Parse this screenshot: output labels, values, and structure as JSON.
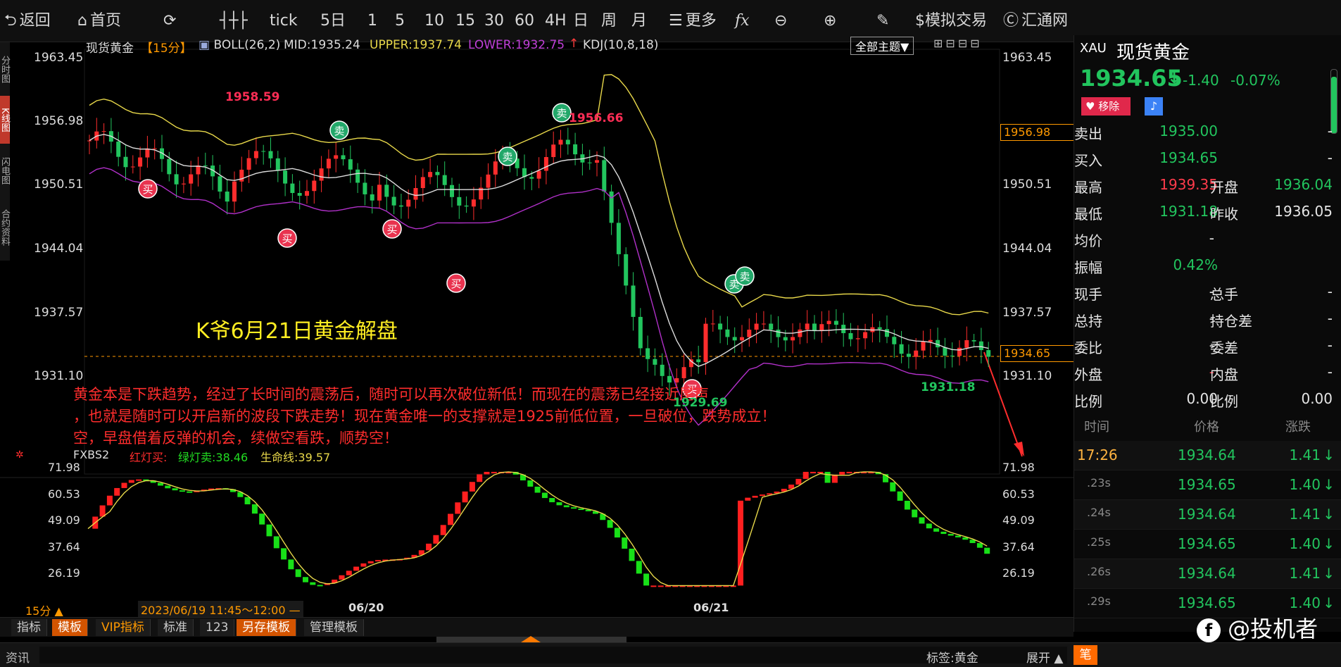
{
  "toolbar": {
    "back": "返回",
    "home": "首页",
    "tick": "tick",
    "periods": [
      "5日",
      "1",
      "5",
      "10",
      "15",
      "30",
      "60",
      "4H",
      "日",
      "周",
      "月"
    ],
    "more": "更多",
    "fx": "fx",
    "draw_icon": "pen-icon",
    "sim_trade": "$模拟交易",
    "huitong": "汇通网"
  },
  "side_tabs": [
    "分时图",
    "K线图",
    "闪电图",
    "合约资料"
  ],
  "legend": {
    "instrument": "现货黄金",
    "period": "【15分】",
    "boll": "BOLL(26,2)",
    "mid": "MID:1935.24",
    "upper": "UPPER:1937.74",
    "lower": "LOWER:1932.75",
    "kdj": "KDJ(10,8,18)",
    "theme_select": "全部主题▼"
  },
  "price_labels": [
    "1963.45",
    "1956.98",
    "1950.51",
    "1944.04",
    "1937.57",
    "1931.10"
  ],
  "highlight_labels": {
    "high": "1956.98",
    "current": "1934.65"
  },
  "annotations": {
    "title": "K爷6月21日黄金解盘",
    "body_lines": [
      "黄金本是下跌趋势，经过了长时间的震荡后，随时可以再次破位新低！而现在的震荡已经接近尾声",
      "，也就是随时可以开启新的波段下跌走势！现在黄金唯一的支撑就是1925前低位置，一旦破位，跌势成立！",
      "空，早盘借着反弹的机会，续做空看跌，顺势空！"
    ],
    "price_marks": [
      "1958.59",
      "1956.66",
      "1929.69",
      "1931.18"
    ],
    "buy": "买",
    "sell": "卖"
  },
  "indicator": {
    "name": "FXBS2",
    "red_label": "红灯买:",
    "green_label": "绿灯卖:38.46",
    "life_label": "生命线:39.57",
    "levels": [
      "71.98",
      "60.53",
      "49.09",
      "37.64",
      "26.19"
    ]
  },
  "time_axis": {
    "period_btn": "15分 ▲",
    "range": "2023/06/19 11:45～12:00 —",
    "dates": [
      "06/20",
      "06/21"
    ]
  },
  "bottom_tabs": [
    "指标",
    "模板",
    "VIP指标",
    "标准",
    "123",
    "另存模板",
    "管理模板"
  ],
  "status_bar": {
    "news": "资讯",
    "tag": "标签:黄金",
    "expand": "展开",
    "note": "笔"
  },
  "quote": {
    "code": "XAU",
    "name": "现货黄金",
    "price": "1934.65",
    "arrow": "↓",
    "change": "-1.40",
    "change_pct": "-0.07%",
    "remove": "移除",
    "rows": [
      [
        {
          "l": "卖出",
          "v": "1935.00",
          "c": "green"
        },
        {
          "l": "",
          "v": "-",
          "c": "white"
        }
      ],
      [
        {
          "l": "买入",
          "v": "1934.65",
          "c": "green"
        },
        {
          "l": "",
          "v": "-",
          "c": "white"
        }
      ],
      [
        {
          "l": "最高",
          "v": "1939.35",
          "c": "red"
        },
        {
          "l": "开盘",
          "v": "1936.04",
          "c": "green"
        }
      ],
      [
        {
          "l": "最低",
          "v": "1931.18",
          "c": "green"
        },
        {
          "l": "昨收",
          "v": "1936.05",
          "c": "white"
        }
      ],
      [
        {
          "l": "均价",
          "v": "-",
          "c": "white"
        },
        {
          "l": "",
          "v": "",
          "c": "white"
        }
      ],
      [
        {
          "l": "振幅",
          "v": "0.42%",
          "c": "green"
        },
        {
          "l": "",
          "v": "",
          "c": "white"
        }
      ],
      [
        {
          "l": "现手",
          "v": "-",
          "c": "white"
        },
        {
          "l": "总手",
          "v": "-",
          "c": "white"
        }
      ],
      [
        {
          "l": "总持",
          "v": "-",
          "c": "white"
        },
        {
          "l": "持仓差",
          "v": "-",
          "c": "white"
        }
      ],
      [
        {
          "l": "委比",
          "v": "-",
          "c": "white"
        },
        {
          "l": "委差",
          "v": "-",
          "c": "white"
        }
      ],
      [
        {
          "l": "外盘",
          "v": "-",
          "c": "red"
        },
        {
          "l": "内盘",
          "v": "-",
          "c": "white"
        }
      ],
      [
        {
          "l": "比例",
          "v": "0.00",
          "c": "white"
        },
        {
          "l": "比例",
          "v": "0.00",
          "c": "white"
        }
      ]
    ],
    "ticker_headers": [
      "时间",
      "价格",
      "涨跌"
    ],
    "ticker": [
      {
        "t": "17:26",
        "p": "1934.64",
        "d": "1.41"
      },
      {
        "t": ".23s",
        "p": "1934.65",
        "d": "1.40"
      },
      {
        "t": ".24s",
        "p": "1934.64",
        "d": "1.41"
      },
      {
        "t": ".25s",
        "p": "1934.65",
        "d": "1.40"
      },
      {
        "t": ".26s",
        "p": "1934.64",
        "d": "1.41"
      },
      {
        "t": ".29s",
        "p": "1934.65",
        "d": "1.40"
      }
    ]
  },
  "watermark": "@投机者",
  "colors": {
    "red": "#ff2d2d",
    "green": "#22c55e",
    "yellow": "#e8d84a",
    "orange": "#ff9900",
    "magenta": "#b030c8",
    "boll_mid": "#dddddd"
  }
}
